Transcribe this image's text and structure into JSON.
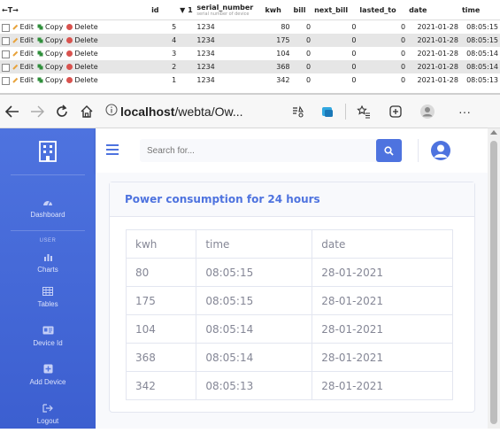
{
  "pma": {
    "header": {
      "arrows": "←T→",
      "id": "id",
      "sort": "▼ 1",
      "serial_number": "serial_number",
      "serial_sub": "serial number of device",
      "kwh": "kwh",
      "bill": "bill",
      "next_bill": "next_bill",
      "lasted_to": "lasted_to",
      "date": "date",
      "time": "time"
    },
    "actions": {
      "edit": "Edit",
      "copy": "Copy",
      "delete": "Delete"
    },
    "rows": [
      {
        "id": "5",
        "serial": "1234",
        "kwh": "80",
        "bill": "0",
        "next_bill": "0",
        "lasted_to": "0",
        "date": "2021-01-28",
        "time": "08:05:15"
      },
      {
        "id": "4",
        "serial": "1234",
        "kwh": "175",
        "bill": "0",
        "next_bill": "0",
        "lasted_to": "0",
        "date": "2021-01-28",
        "time": "08:05:15"
      },
      {
        "id": "3",
        "serial": "1234",
        "kwh": "104",
        "bill": "0",
        "next_bill": "0",
        "lasted_to": "0",
        "date": "2021-01-28",
        "time": "08:05:14"
      },
      {
        "id": "2",
        "serial": "1234",
        "kwh": "368",
        "bill": "0",
        "next_bill": "0",
        "lasted_to": "0",
        "date": "2021-01-28",
        "time": "08:05:14"
      },
      {
        "id": "1",
        "serial": "1234",
        "kwh": "342",
        "bill": "0",
        "next_bill": "0",
        "lasted_to": "0",
        "date": "2021-01-28",
        "time": "08:05:13"
      }
    ]
  },
  "browser": {
    "url_host": "localhost",
    "url_path": "/webta/Ow...",
    "icons": [
      "back-icon",
      "forward-icon",
      "reload-icon",
      "home-icon",
      "info-icon",
      "reader-mode-icon",
      "collections-icon",
      "favorites-icon",
      "extensions-icon",
      "profile-icon",
      "more-icon"
    ],
    "more": "···"
  },
  "sidebar": {
    "items": [
      {
        "label": "Dashboard",
        "icon": "dashboard-icon"
      },
      {
        "label": "Charts",
        "icon": "chart-icon"
      },
      {
        "label": "Tables",
        "icon": "table-icon"
      },
      {
        "label": "Device Id",
        "icon": "id-card-icon"
      },
      {
        "label": "Add Device",
        "icon": "plus-icon"
      },
      {
        "label": "Logout",
        "icon": "logout-icon"
      }
    ],
    "section": "USER"
  },
  "topbar": {
    "search_placeholder": "Search for..."
  },
  "card": {
    "title": "Power consumption for 24 hours",
    "columns": [
      "kwh",
      "time",
      "date"
    ],
    "rows": [
      [
        "80",
        "08:05:15",
        "28-01-2021"
      ],
      [
        "175",
        "08:05:15",
        "28-01-2021"
      ],
      [
        "104",
        "08:05:14",
        "28-01-2021"
      ],
      [
        "368",
        "08:05:14",
        "28-01-2021"
      ],
      [
        "342",
        "08:05:13",
        "28-01-2021"
      ]
    ]
  },
  "colors": {
    "primary": "#4e73df",
    "muted": "#858796",
    "danger": "#d9534f"
  }
}
